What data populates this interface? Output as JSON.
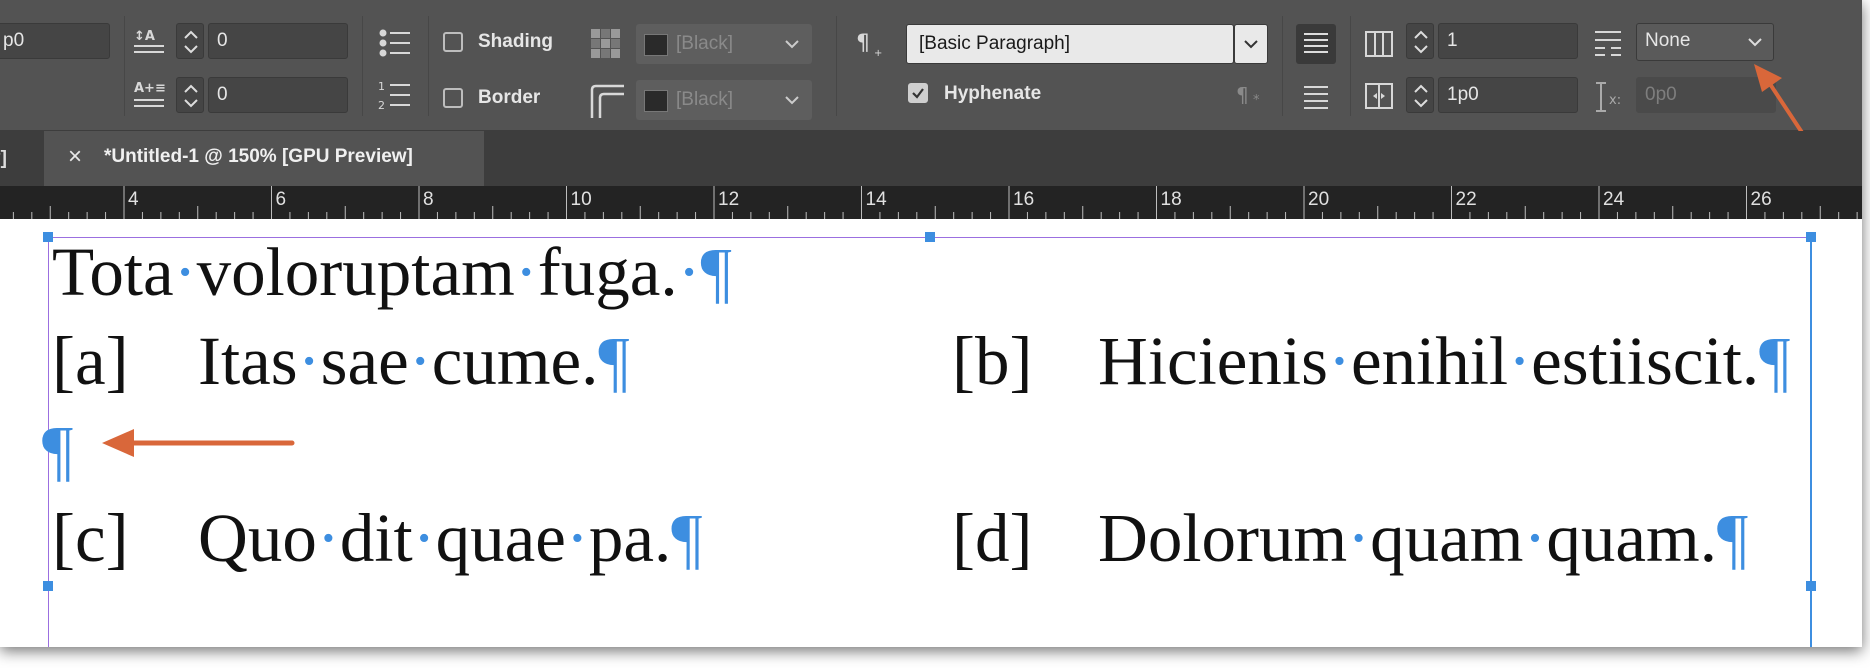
{
  "panel": {
    "leading_partial": "p0",
    "space_before": "0",
    "space_after": "0",
    "shading_label": "Shading",
    "border_label": "Border",
    "shading_color": "[Black]",
    "border_color": "[Black]",
    "paragraph_style": "[Basic Paragraph]",
    "hyphenate_label": "Hyphenate",
    "hyphenate_checked": true,
    "columns": "1",
    "column_gutter": "1p0",
    "span_columns": "None",
    "baseline_shift": "0p0"
  },
  "tabs": {
    "prev_tab_partial": "y]",
    "active_tab": "*Untitled-1 @ 150% [GPU Preview]",
    "close_glyph": "×"
  },
  "ruler": [
    "4",
    "6",
    "8",
    "10",
    "12",
    "14",
    "16",
    "18",
    "20",
    "22",
    "24",
    "26"
  ],
  "document": {
    "heading_words": [
      "Tota",
      "voloruptam",
      "fuga."
    ],
    "item_a_label": "[a]",
    "item_a_words": [
      "Itas",
      "sae",
      "cume."
    ],
    "item_b_label": "[b]",
    "item_b_words": [
      "Hicienis",
      "enihil",
      "estiiscit."
    ],
    "item_c_label": "[c]",
    "item_c_words": [
      "Quo",
      "dit",
      "quae",
      "pa."
    ],
    "item_d_label": "[d]",
    "item_d_words": [
      "Dolorum",
      "quam",
      "quam."
    ],
    "pilcrow": "¶",
    "space_dot": "·"
  },
  "colors": {
    "panel_bg": "#535353",
    "ruler_bg": "#232323",
    "frame_blue": "#3d8ee0",
    "arrow_orange": "#d9673a"
  }
}
